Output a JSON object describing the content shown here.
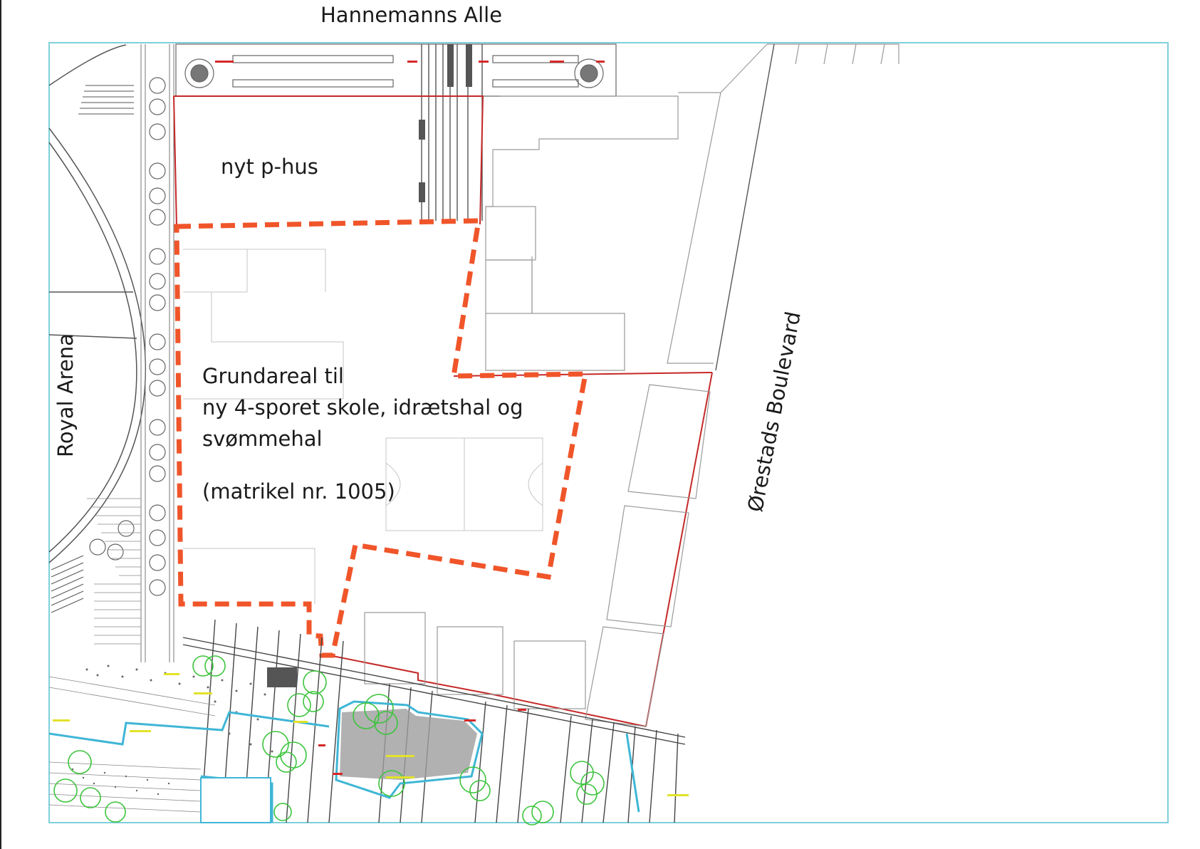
{
  "streets": {
    "north": "Hannemanns Alle",
    "west": "Royal Arena",
    "east": "Ørestads Boulevard"
  },
  "areas": {
    "parking": "nyt p-hus"
  },
  "plot": {
    "line1": "Grundareal til",
    "line2": "ny 4-sporet skole, idrætshal og",
    "line3": "svømmehal",
    "line4": "(matrikel nr. 1005)"
  },
  "colors": {
    "frame": "#7fcfdc",
    "plot_boundary": "#f0552a",
    "property_line": "#c62828",
    "drawing_lines": "#8a8a8a",
    "trees": "#3cc43c",
    "annotations": "#e2e22a",
    "water": "#3fb6d6"
  }
}
